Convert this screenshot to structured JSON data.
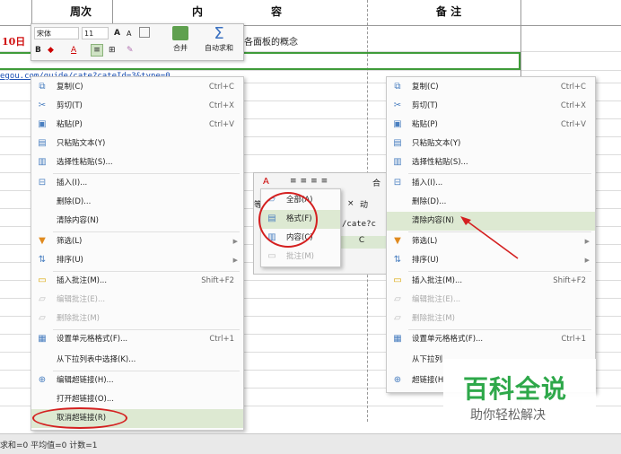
{
  "sheet": {
    "headers": [
      "周次",
      "内",
      "容",
      "备  注"
    ],
    "row_date_fragment": "10日",
    "row_content_fragment": "各面板的概念",
    "url_fragment": "egou.com/guide/cate?cateId=3&type=0",
    "url_fragment_2": "/cate?c",
    "col_letter": "C"
  },
  "mini_toolbar": {
    "font_name": "宋体",
    "font_size": "11",
    "grow_font": "A",
    "shrink_font": "A",
    "bold": "B",
    "merge_label": "合并",
    "autosum_label": "自动求和"
  },
  "menu_left": {
    "items": [
      {
        "label": "复制(C)",
        "shortcut": "Ctrl+C",
        "icon": "copy-icon"
      },
      {
        "label": "剪切(T)",
        "shortcut": "Ctrl+X",
        "icon": "scissors-icon"
      },
      {
        "label": "粘贴(P)",
        "shortcut": "Ctrl+V",
        "icon": "paste-icon"
      },
      {
        "label": "只粘贴文本(Y)",
        "shortcut": "",
        "icon": "paste-text-icon"
      },
      {
        "label": "选择性粘贴(S)...",
        "shortcut": "",
        "icon": "paste-special-icon"
      },
      {
        "label": "插入(I)...",
        "shortcut": "",
        "icon": "insert-icon"
      },
      {
        "label": "删除(D)...",
        "shortcut": "",
        "icon": ""
      },
      {
        "label": "清除内容(N)",
        "shortcut": "",
        "icon": ""
      },
      {
        "label": "筛选(L)",
        "shortcut": "",
        "icon": "filter-icon"
      },
      {
        "label": "排序(U)",
        "shortcut": "",
        "icon": "sort-icon"
      },
      {
        "label": "插入批注(M)...",
        "shortcut": "Shift+F2",
        "icon": "insert-comment-icon"
      },
      {
        "label": "编辑批注(E)...",
        "shortcut": "",
        "icon": "edit-comment-icon"
      },
      {
        "label": "删除批注(M)",
        "shortcut": "",
        "icon": "delete-comment-icon"
      },
      {
        "label": "设置单元格格式(F)...",
        "shortcut": "Ctrl+1",
        "icon": "format-cells-icon"
      },
      {
        "label": "从下拉列表中选择(K)...",
        "shortcut": "",
        "icon": ""
      },
      {
        "label": "编辑超链接(H)...",
        "shortcut": "",
        "icon": "hyperlink-icon"
      },
      {
        "label": "打开超链接(O)...",
        "shortcut": "",
        "icon": ""
      },
      {
        "label": "取消超链接(R)",
        "shortcut": "",
        "icon": ""
      }
    ]
  },
  "menu_right": {
    "items": [
      {
        "label": "复制(C)",
        "shortcut": "Ctrl+C"
      },
      {
        "label": "剪切(T)",
        "shortcut": "Ctrl+X"
      },
      {
        "label": "粘贴(P)",
        "shortcut": "Ctrl+V"
      },
      {
        "label": "只粘贴文本(Y)",
        "shortcut": ""
      },
      {
        "label": "选择性粘贴(S)...",
        "shortcut": ""
      },
      {
        "label": "插入(I)...",
        "shortcut": ""
      },
      {
        "label": "删除(D)...",
        "shortcut": ""
      },
      {
        "label": "清除内容(N)",
        "shortcut": ""
      },
      {
        "label": "筛选(L)",
        "shortcut": ""
      },
      {
        "label": "排序(U)",
        "shortcut": ""
      },
      {
        "label": "插入批注(M)...",
        "shortcut": "Shift+F2"
      },
      {
        "label": "编辑批注(E)...",
        "shortcut": ""
      },
      {
        "label": "删除批注(M)",
        "shortcut": ""
      },
      {
        "label": "设置单元格格式(F)...",
        "shortcut": "Ctrl+1"
      },
      {
        "label": "从下拉列",
        "shortcut": ""
      },
      {
        "label": "超链接(H",
        "shortcut": ""
      }
    ]
  },
  "clear_submenu": {
    "items": [
      "全部(A)",
      "格式(F)",
      "内容(C)",
      "批注(M)"
    ]
  },
  "mid_toolbar": {
    "merge_label": "合",
    "frag1": "等",
    "frag2": "动"
  },
  "watermark": {
    "title": "百科全说",
    "subtitle": "助你轻松解决"
  },
  "status_bar": {
    "text": "求和=0  平均值=0  计数=1"
  },
  "colors": {
    "highlight": "#dde9d2",
    "annotation_red": "#d42020",
    "watermark_green": "#2ea84a",
    "selection_green": "#3f9b3a"
  }
}
